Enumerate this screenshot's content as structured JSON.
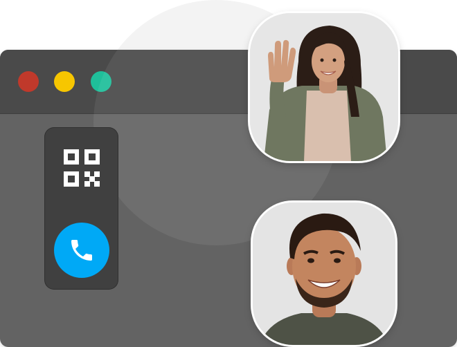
{
  "window": {
    "background": "#636363",
    "titlebar_color": "#4a4a4a",
    "traffic_lights": {
      "close": "#c0392b",
      "minimize": "#f7c600",
      "maximize": "#1fbf9a"
    }
  },
  "sidebar": {
    "qr_icon": "qr-code-icon",
    "call_icon": "phone-icon",
    "call_color": "#00a9f6"
  },
  "participants": [
    {
      "role": "waving-woman"
    },
    {
      "role": "smiling-man"
    }
  ]
}
